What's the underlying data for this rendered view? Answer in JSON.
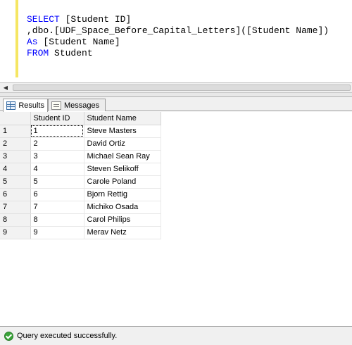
{
  "editor": {
    "lines": [
      [
        {
          "t": "SELECT",
          "k": "kw"
        },
        {
          "t": " [Student ID]",
          "k": "id"
        }
      ],
      [
        {
          "t": ",dbo.[UDF_Space_Before_Capital_Letters]([Student Name])",
          "k": "id"
        }
      ],
      [
        {
          "t": "As",
          "k": "kw"
        },
        {
          "t": " [Student Name]",
          "k": "id"
        }
      ],
      [
        {
          "t": "FROM",
          "k": "kw"
        },
        {
          "t": " Student",
          "k": "id"
        }
      ]
    ]
  },
  "tabs": {
    "results_label": "Results",
    "messages_label": "Messages"
  },
  "grid": {
    "columns": [
      "Student ID",
      "Student Name"
    ],
    "rows": [
      {
        "row": "1",
        "id": "1",
        "name": "Steve Masters"
      },
      {
        "row": "2",
        "id": "2",
        "name": "David Ortiz"
      },
      {
        "row": "3",
        "id": "3",
        "name": "Michael Sean Ray"
      },
      {
        "row": "4",
        "id": "4",
        "name": "Steven Selikoff"
      },
      {
        "row": "5",
        "id": "5",
        "name": "Carole Poland"
      },
      {
        "row": "6",
        "id": "6",
        "name": "Bjorn Rettig"
      },
      {
        "row": "7",
        "id": "7",
        "name": "Michiko Osada"
      },
      {
        "row": "8",
        "id": "8",
        "name": "Carol Philips"
      },
      {
        "row": "9",
        "id": "9",
        "name": "Merav Netz"
      }
    ]
  },
  "status": {
    "message": "Query executed successfully.",
    "icon": "success-check-icon"
  },
  "colors": {
    "keyword": "#0000ff",
    "margin_bar": "#f5e663"
  }
}
